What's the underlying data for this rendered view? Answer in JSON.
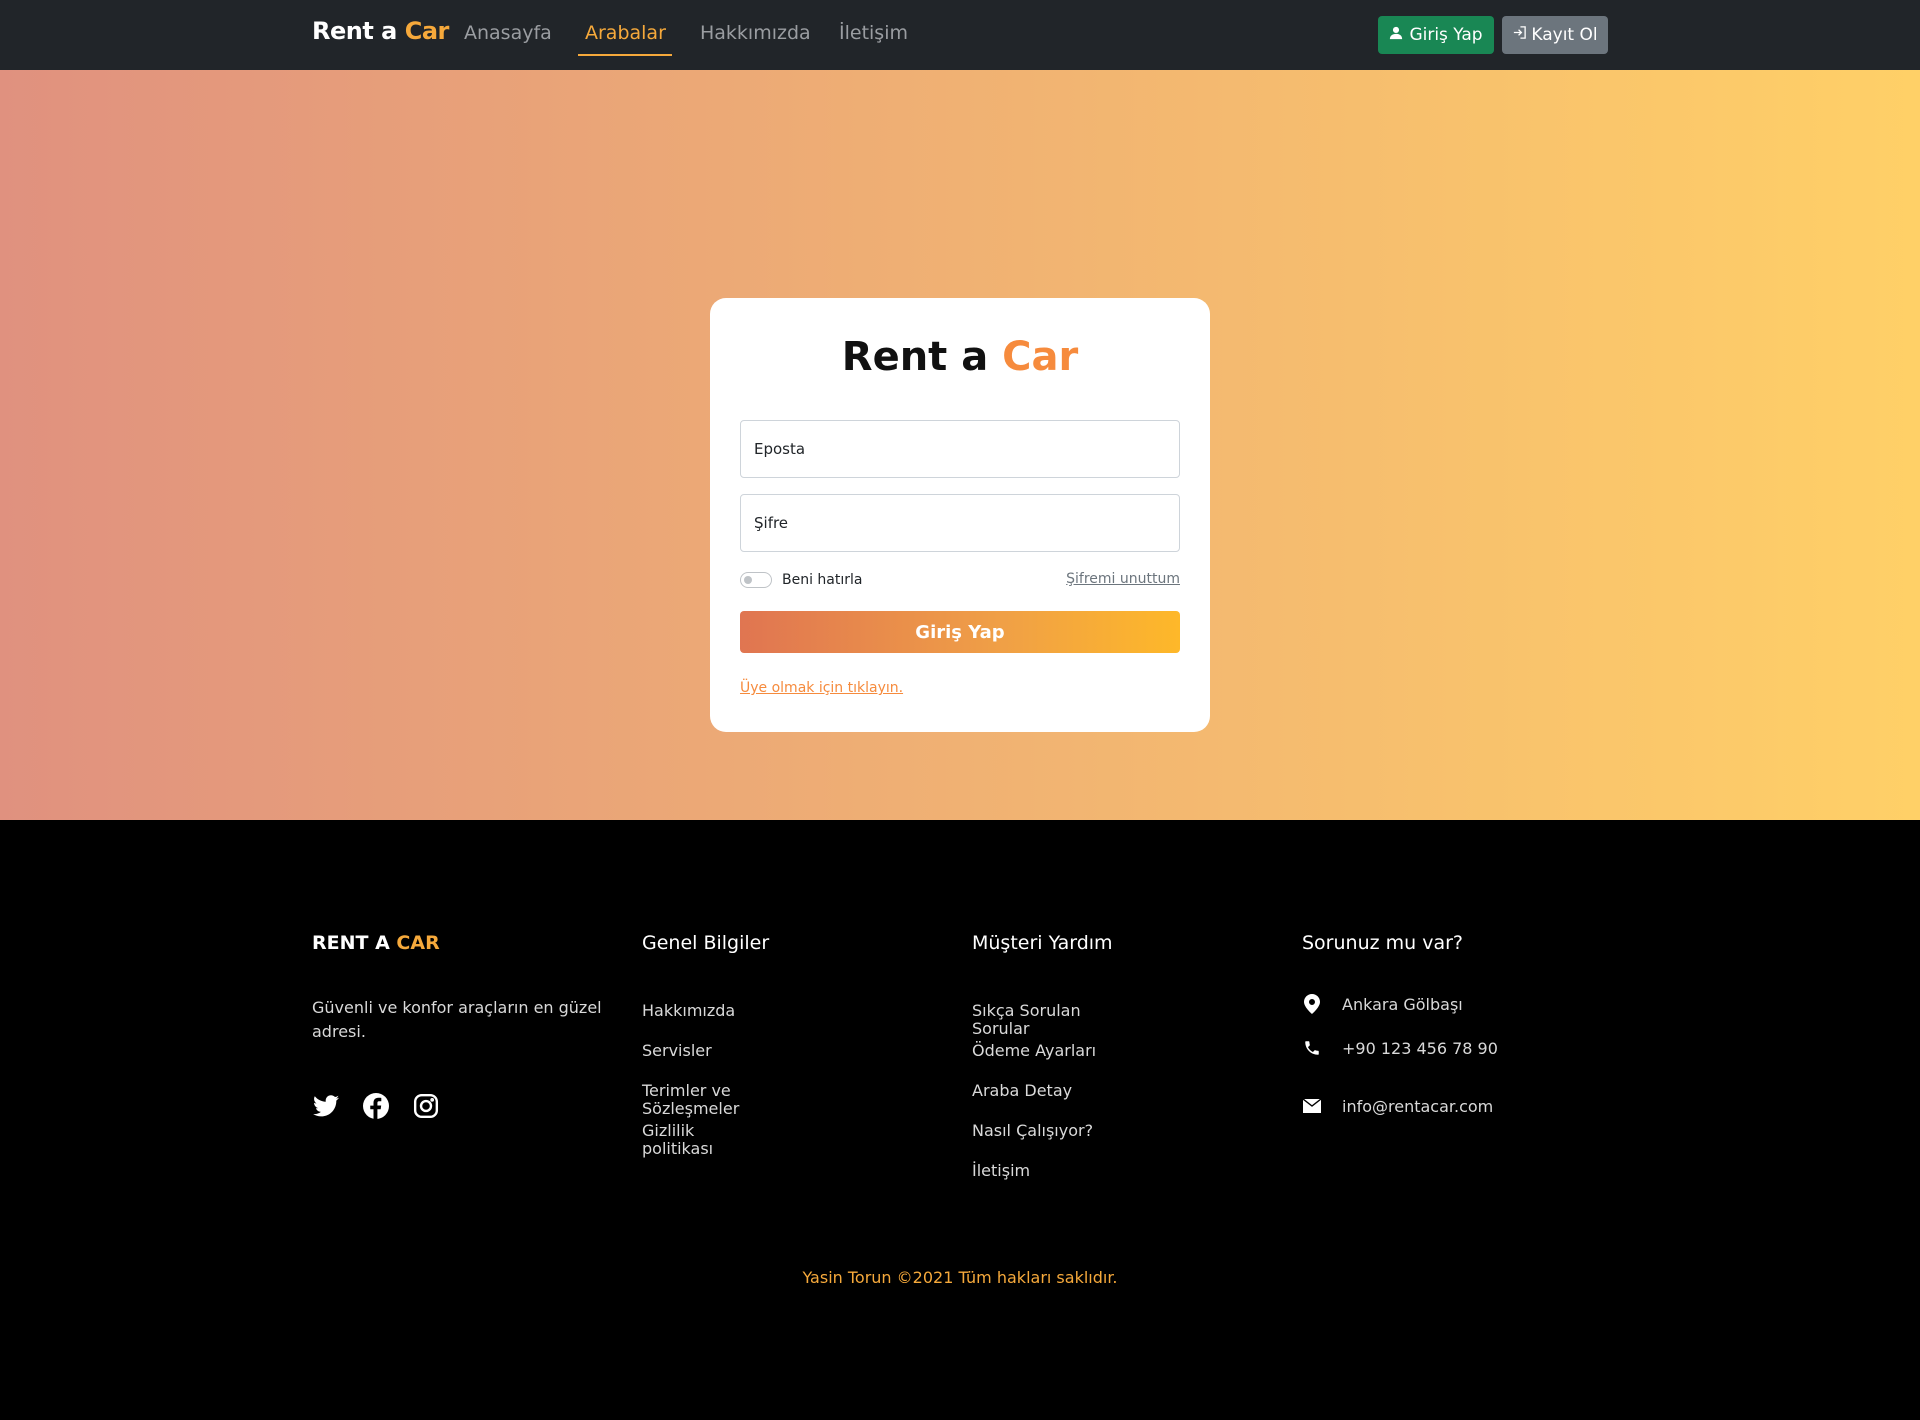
{
  "navbar": {
    "brand_main": "Rent a",
    "brand_accent": "Car",
    "links": [
      "Anasayfa",
      "Arabalar",
      "Hakkımızda",
      "İletişim"
    ],
    "login_label": "Giriş Yap",
    "register_label": "Kayıt Ol"
  },
  "login_card": {
    "title_main": "Rent a",
    "title_accent": "Car",
    "email_placeholder": "Eposta",
    "password_placeholder": "Şifre",
    "remember_label": "Beni hatırla",
    "forgot_label": "Şifremi unuttum",
    "submit_label": "Giriş Yap",
    "signup_label": "Üye olmak için tıklayın."
  },
  "footer": {
    "brand_main": "RENT A",
    "brand_accent": "CAR",
    "description": "Güvenli ve konfor araçların en güzel adresi.",
    "general": {
      "title": "Genel Bilgiler",
      "links": [
        "Hakkımızda",
        "Servisler",
        "Terimler ve Sözleşmeler",
        "Gizlilik politikası"
      ]
    },
    "help": {
      "title": "Müşteri Yardım",
      "links": [
        "Sıkça Sorulan Sorular",
        "Ödeme Ayarları",
        "Araba Detay",
        "Nasıl Çalışıyor?",
        "İletişim"
      ]
    },
    "contact": {
      "title": "Sorunuz mu var?",
      "address": "Ankara Gölbaşı",
      "phone": "+90 123 456 78 90",
      "email": "info@rentacar.com"
    },
    "copyright": "Yasin Torun ©2021 Tüm hakları saklıdır."
  },
  "colors": {
    "accent": "#f6a93b",
    "navbar_bg": "#212529",
    "login_button": "#198754",
    "register_button": "#6c757d"
  },
  "icons": [
    "user-icon",
    "sign-in-icon",
    "twitter-icon",
    "facebook-icon",
    "instagram-icon",
    "map-pin-icon",
    "phone-icon",
    "mail-icon"
  ]
}
